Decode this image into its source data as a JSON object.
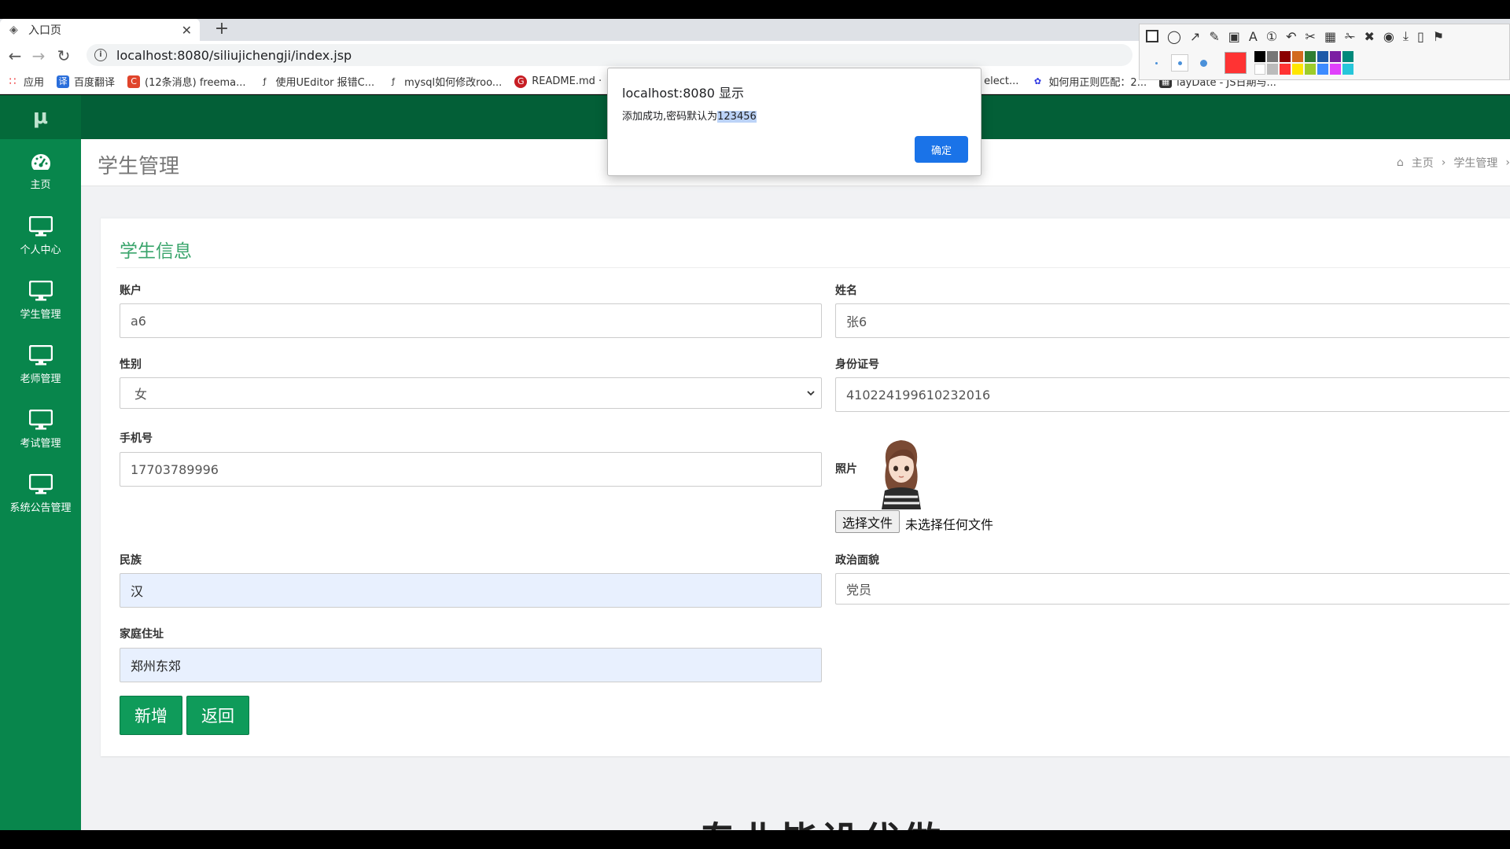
{
  "browser": {
    "tab_title": "入口页",
    "url": "localhost:8080/siliujichengji/index.jsp",
    "bookmarks": [
      "应用",
      "百度翻译",
      "(12条消息) freema...",
      "使用UEditor 报错C...",
      "mysql如何修改roo...",
      "README.md ·",
      "elect...",
      "如何用正则匹配：2...",
      "layDate - JS日期与..."
    ]
  },
  "sidebar": {
    "logo": "μ",
    "items": [
      {
        "label": "主页",
        "icon": "dashboard-icon"
      },
      {
        "label": "个人中心",
        "icon": "monitor-icon"
      },
      {
        "label": "学生管理",
        "icon": "monitor-icon"
      },
      {
        "label": "老师管理",
        "icon": "monitor-icon"
      },
      {
        "label": "考试管理",
        "icon": "monitor-icon"
      },
      {
        "label": "系统公告管理",
        "icon": "monitor-icon"
      }
    ]
  },
  "header": {
    "page_title": "学生管理",
    "breadcrumb": [
      "主页",
      "学生管理"
    ]
  },
  "form": {
    "card_title": "学生信息",
    "account_label": "账户",
    "account_value": "a6",
    "name_label": "姓名",
    "name_value": "张6",
    "gender_label": "性别",
    "gender_value": "女",
    "id_label": "身份证号",
    "id_value": "410224199610232016",
    "phone_label": "手机号",
    "phone_value": "17703789996",
    "photo_label": "照片",
    "file_button": "选择文件",
    "file_status": "未选择任何文件",
    "ethnicity_label": "民族",
    "ethnicity_value": "汉",
    "political_label": "政治面貌",
    "political_value": "党员",
    "address_label": "家庭住址",
    "address_value": "郑州东郊",
    "add_button": "新增",
    "back_button": "返回"
  },
  "dialog": {
    "title": "localhost:8080 显示",
    "message_prefix": "添加成功,密码默认为",
    "message_highlight": "123456",
    "ok_button": "确定"
  },
  "watermark": "专业毕设代做",
  "colors": {
    "sidebar": "#08864c",
    "topnav": "#035f37",
    "accent_green": "#3aa56c",
    "button_green": "#0f9b5a",
    "dialog_button": "#1a73e8"
  }
}
